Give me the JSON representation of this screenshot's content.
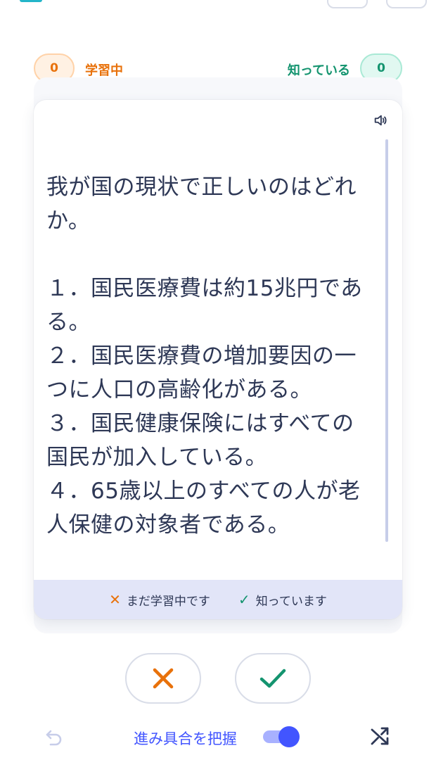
{
  "counters": {
    "learning": {
      "count": "0",
      "label": "学習中"
    },
    "known": {
      "count": "0",
      "label": "知っている"
    }
  },
  "card": {
    "text": "我が国の現状で正しいのはどれか。\n\n１．国民医療費は約15兆円である。\n２．国民医療費の増加要因の一つに人口の高齢化がある。\n３．国民健康保険にはすべての国民が加入している。\n４．65歳以上のすべての人が老人保健の対象者である。",
    "audio_icon": "speaker-icon"
  },
  "hints": {
    "still_learning": "まだ学習中です",
    "know_it": "知っています"
  },
  "bottom": {
    "progress_label": "進み具合を把握",
    "progress_toggle_on": true
  },
  "colors": {
    "learning": "#e8710a",
    "known": "#14946f",
    "accent": "#4255ff"
  }
}
